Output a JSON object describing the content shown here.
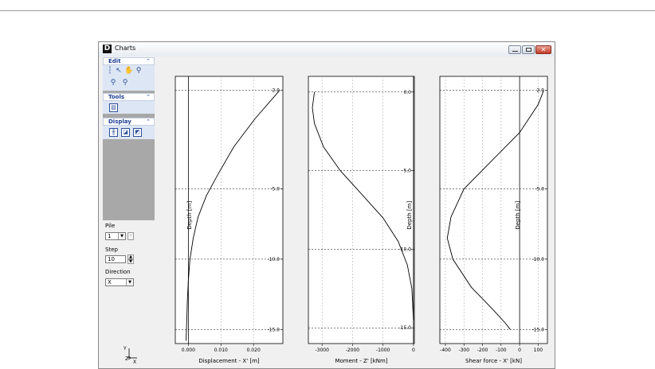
{
  "window": {
    "title": "Charts",
    "app_icon": "D",
    "close_glyph": "✕"
  },
  "panel": {
    "sections": [
      {
        "title": "Edit",
        "tools": [
          "select-arrow-icon",
          "arrow-icon",
          "pan-hand-icon",
          "zoom-icon",
          "zoom-in-icon",
          "zoom-out-icon"
        ]
      },
      {
        "title": "Tools",
        "tools": [
          "chart-settings-icon"
        ]
      },
      {
        "title": "Display",
        "tools": [
          "fit-view-icon",
          "display-mode-1-icon",
          "display-mode-2-icon"
        ]
      }
    ],
    "collapse_glyph": "⌃"
  },
  "controls": {
    "pile_label": "Pile",
    "pile_value": "1",
    "step_label": "Step",
    "step_value": "10",
    "direction_label": "Direction",
    "direction_value": "X"
  },
  "axis_icon": {
    "y": "Y",
    "x": "X",
    "z": "Z"
  },
  "colors": {
    "title_accent": "#1c3f94",
    "close_button": "#c33b2a",
    "chart_line": "#000000",
    "grid": "#b0b0b0"
  },
  "chart_data": [
    {
      "type": "line",
      "xlabel": "Displacement - X' [m]",
      "ylabel": "Depth [m]",
      "xticks": [
        "0.000",
        "0.010",
        "0.020"
      ],
      "xtick_values": [
        0,
        0.01,
        0.02
      ],
      "yticks": [
        "2.0",
        "-5.0",
        "-10.0",
        "-15.0"
      ],
      "ytick_values": [
        2,
        -5,
        -10,
        -15
      ],
      "xlim": [
        -0.004,
        0.029
      ],
      "ylim": [
        -16,
        3
      ],
      "series": [
        {
          "x": [
            0.028,
            0.0205,
            0.014,
            0.009,
            0.0055,
            0.003,
            0.0015,
            0.0005,
            0.0,
            -0.0003,
            -0.0005,
            -0.0007
          ],
          "y": [
            2,
            0,
            -2,
            -4,
            -5.5,
            -7,
            -8.5,
            -10,
            -11.5,
            -13,
            -14.5,
            -15.8
          ]
        }
      ]
    },
    {
      "type": "line",
      "xlabel": "Moment - Z' [kNm]",
      "ylabel": "Depth [m]",
      "xticks": [
        "-3000",
        "-2000",
        "-1000",
        "0"
      ],
      "xtick_values": [
        -3000,
        -2000,
        -1000,
        0
      ],
      "yticks": [
        "0.0",
        "-5.0",
        "-10.0",
        "-15.0"
      ],
      "ytick_values": [
        0,
        -5,
        -10,
        -15
      ],
      "xlim": [
        -3450,
        30
      ],
      "ylim": [
        -16,
        1
      ],
      "series": [
        {
          "x": [
            -3250,
            -3320,
            -3250,
            -2950,
            -2400,
            -1700,
            -1000,
            -500,
            -200,
            -50,
            0
          ],
          "y": [
            0,
            -1,
            -2,
            -3.5,
            -5,
            -6.5,
            -8,
            -9.5,
            -11,
            -12.5,
            -14.5
          ]
        }
      ]
    },
    {
      "type": "line",
      "xlabel": "Shear force - X' [kN]",
      "ylabel": "Depth [m]",
      "xticks": [
        "-400",
        "-300",
        "-200",
        "-100",
        "0",
        "100"
      ],
      "xtick_values": [
        -400,
        -300,
        -200,
        -100,
        0,
        100
      ],
      "yticks": [
        "2.0",
        "-5.0",
        "-10.0",
        "-15.0"
      ],
      "ytick_values": [
        2,
        -5,
        -10,
        -15
      ],
      "xlim": [
        -430,
        150
      ],
      "ylim": [
        -16,
        3
      ],
      "series": [
        {
          "x": [
            130,
            100,
            0,
            -150,
            -300,
            -370,
            -390,
            -360,
            -260,
            -150,
            -80,
            -50
          ],
          "y": [
            2,
            1,
            -1,
            -3,
            -5,
            -7,
            -8.5,
            -10,
            -12,
            -13.5,
            -14.5,
            -15
          ]
        }
      ]
    }
  ]
}
